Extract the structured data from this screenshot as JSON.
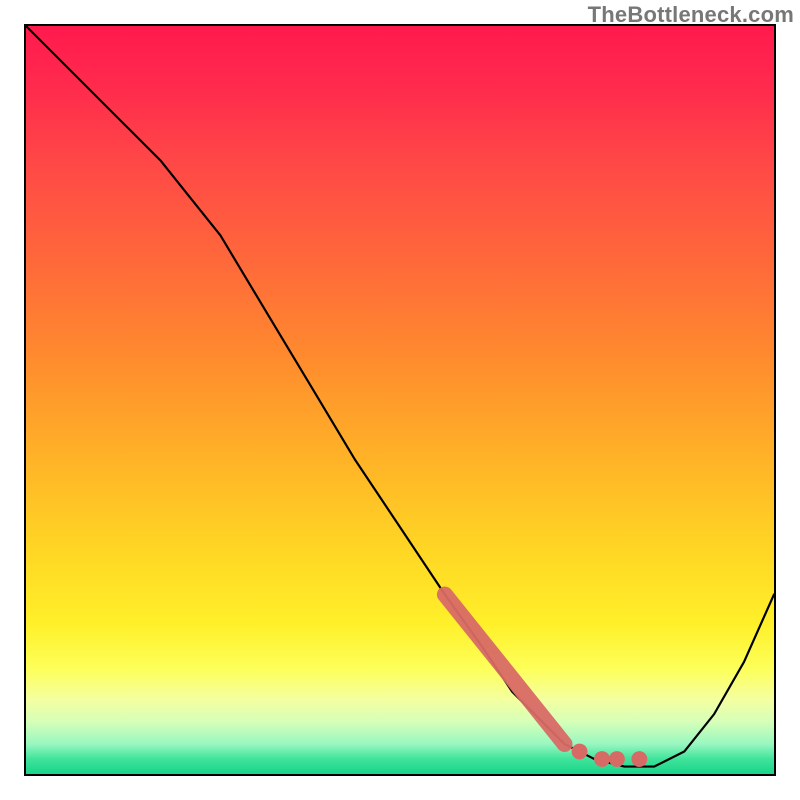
{
  "watermark": "TheBottleneck.com",
  "colors": {
    "accent_marker": "#d86a66",
    "curve": "#000000",
    "frame": "#000000"
  },
  "chart_data": {
    "type": "line",
    "title": "",
    "xlabel": "",
    "ylabel": "",
    "xlim": [
      0,
      100
    ],
    "ylim": [
      0,
      100
    ],
    "grid": false,
    "legend": false,
    "series": [
      {
        "name": "bottleneck-curve",
        "x": [
          0,
          6,
          12,
          18,
          22,
          26,
          32,
          38,
          44,
          50,
          56,
          61,
          65,
          69,
          72,
          76,
          80,
          84,
          88,
          92,
          96,
          100
        ],
        "y": [
          100,
          94,
          88,
          82,
          77,
          72,
          62,
          52,
          42,
          33,
          24,
          17,
          11,
          7,
          4,
          2,
          1,
          1,
          3,
          8,
          15,
          24
        ]
      }
    ],
    "annotations": [
      {
        "name": "highlight-band",
        "kind": "segment",
        "x": [
          56,
          72
        ],
        "y": [
          24,
          4
        ],
        "color": "#d86a66",
        "thick": true
      },
      {
        "name": "highlight-dots",
        "kind": "points",
        "points": [
          {
            "x": 74,
            "y": 3
          },
          {
            "x": 77,
            "y": 2
          },
          {
            "x": 79,
            "y": 2
          },
          {
            "x": 82,
            "y": 2
          }
        ],
        "color": "#d86a66",
        "r": 8
      }
    ]
  }
}
